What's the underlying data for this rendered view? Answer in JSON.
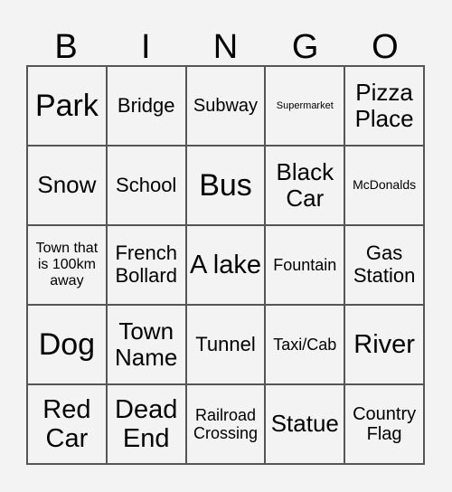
{
  "header": [
    "B",
    "I",
    "N",
    "G",
    "O"
  ],
  "cells": [
    "Park",
    "Bridge",
    "Subway",
    "Supermarket",
    "Pizza Place",
    "Snow",
    "School",
    "Bus",
    "Black Car",
    "McDonalds",
    "Town that is 100km away",
    "French Bollard",
    "A lake",
    "Fountain",
    "Gas Station",
    "Dog",
    "Town Name",
    "Tunnel",
    "Taxi/Cab",
    "River",
    "Red Car",
    "Dead End",
    "Railroad Crossing",
    "Statue",
    "Country Flag"
  ]
}
